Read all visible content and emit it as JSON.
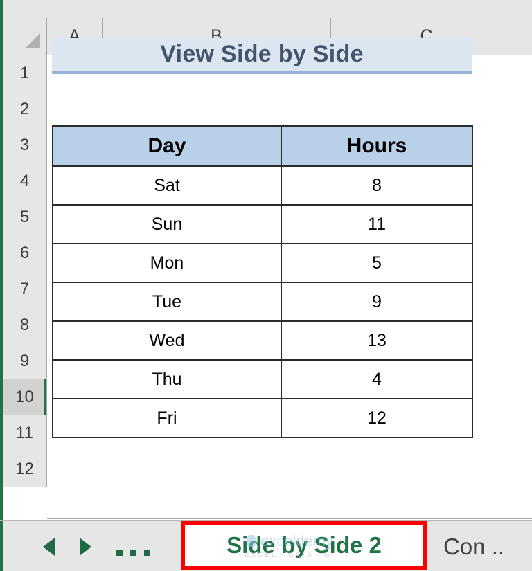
{
  "app": {
    "type": "spreadsheet",
    "accent_green": "#217346",
    "highlight_red": "#ff0000"
  },
  "grid": {
    "column_headers": [
      "A",
      "B",
      "C"
    ],
    "row_headers": [
      "1",
      "2",
      "3",
      "4",
      "5",
      "6",
      "7",
      "8",
      "9",
      "10",
      "11",
      "12"
    ],
    "active_row": "10",
    "select_all_icon": "triangle-icon"
  },
  "banner": {
    "title": "View Side by Side",
    "fill_color": "#dce6f1",
    "text_color": "#44546a",
    "underline_color": "#95b3d7"
  },
  "table": {
    "headers": [
      "Day",
      "Hours"
    ],
    "header_fill": "#b8d0e8",
    "rows": [
      {
        "day": "Sat",
        "hours": "8"
      },
      {
        "day": "Sun",
        "hours": "11"
      },
      {
        "day": "Mon",
        "hours": "5"
      },
      {
        "day": "Tue",
        "hours": "9"
      },
      {
        "day": "Wed",
        "hours": "13"
      },
      {
        "day": "Thu",
        "hours": "4"
      },
      {
        "day": "Fri",
        "hours": "12"
      }
    ]
  },
  "sheet_tabs": {
    "prev_arrow": "triangle-left-icon",
    "next_arrow": "triangle-right-icon",
    "more_tabs": "ellipsis-icon",
    "active_tab": "Side by Side 2",
    "inactive_tab": "Con .."
  },
  "watermark": {
    "brand": "exceldemy",
    "tagline": "EXCEL  ·  DATA  ·  BI"
  }
}
